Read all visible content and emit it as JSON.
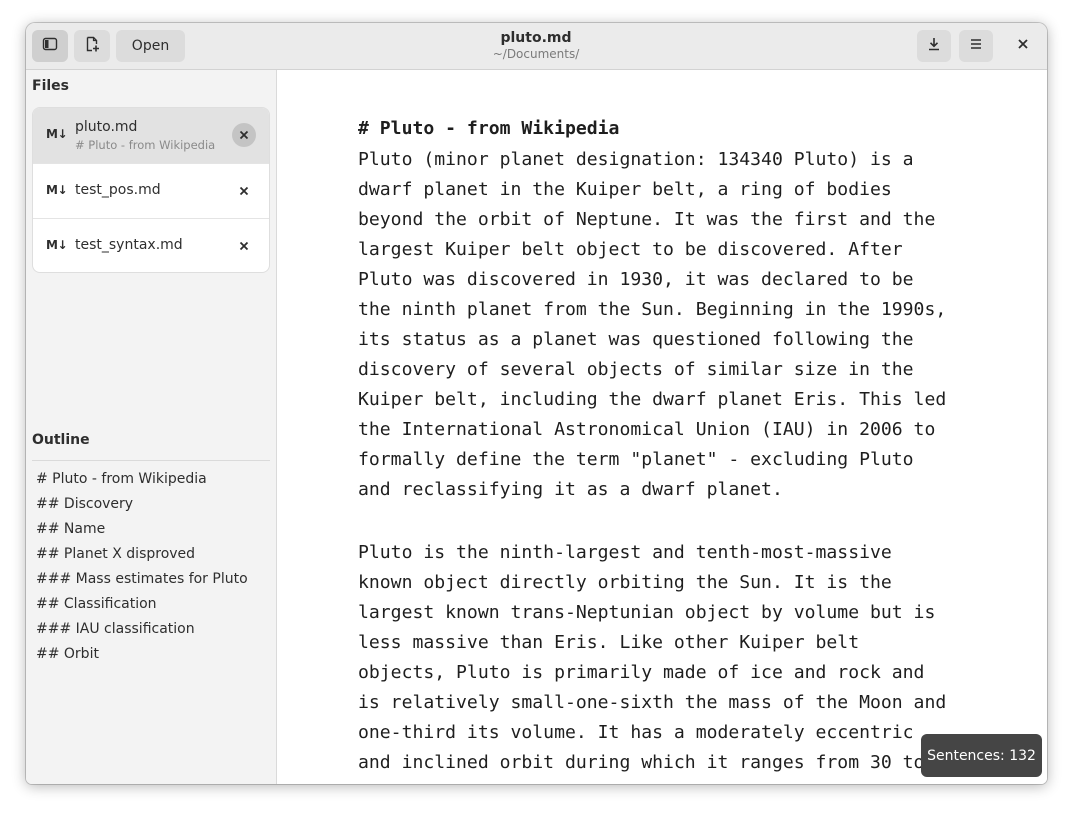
{
  "header": {
    "title": "pluto.md",
    "subtitle": "~/Documents/",
    "open_label": "Open",
    "sidebar_toggle_icon": "sidebar-icon",
    "new_file_icon": "new-document-icon",
    "save_icon": "download-icon",
    "menu_icon": "hamburger-menu-icon",
    "close_icon": "close-icon"
  },
  "sidebar": {
    "files_title": "Files",
    "files": [
      {
        "icon_text": "M↓",
        "name": "pluto.md",
        "subtitle": "# Pluto - from Wikipedia",
        "selected": true
      },
      {
        "icon_text": "M↓",
        "name": "test_pos.md",
        "subtitle": "",
        "selected": false
      },
      {
        "icon_text": "M↓",
        "name": "test_syntax.md",
        "subtitle": "",
        "selected": false
      }
    ],
    "outline_title": "Outline",
    "outline": [
      "# Pluto - from Wikipedia",
      "## Discovery",
      "## Name",
      "## Planet X disproved",
      "### Mass estimates for Pluto",
      "## Classification",
      "### IAU classification",
      "## Orbit"
    ]
  },
  "editor": {
    "heading": "# Pluto - from Wikipedia",
    "paragraph1": "Pluto (minor planet designation: 134340 Pluto) is a\ndwarf planet in the Kuiper belt, a ring of bodies\nbeyond the orbit of Neptune. It was the first and the\nlargest Kuiper belt object to be discovered. After\nPluto was discovered in 1930, it was declared to be\nthe ninth planet from the Sun. Beginning in the 1990s,\nits status as a planet was questioned following the\ndiscovery of several objects of similar size in the\nKuiper belt, including the dwarf planet Eris. This led\nthe International Astronomical Union (IAU) in 2006 to\nformally define the term \"planet\" - excluding Pluto\nand reclassifying it as a dwarf planet.",
    "paragraph2": "Pluto is the ninth-largest and tenth-most-massive\nknown object directly orbiting the Sun. It is the\nlargest known trans-Neptunian object by volume but is\nless massive than Eris. Like other Kuiper belt\nobjects, Pluto is primarily made of ice and rock and\nis relatively small-one-sixth the mass of the Moon and\none-third its volume. It has a moderately eccentric\nand inclined orbit during which it ranges from 30 to"
  },
  "toast": {
    "text": "Sentences: 132"
  }
}
